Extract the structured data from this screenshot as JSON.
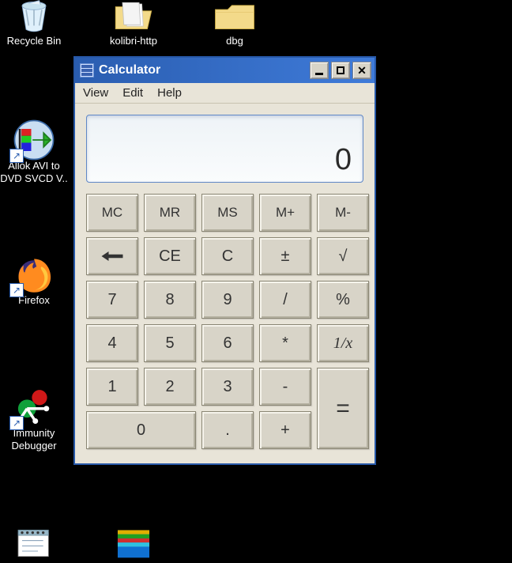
{
  "desktop": {
    "recycle_bin": "Recycle Bin",
    "kolibri": "kolibri-http",
    "dbg": "dbg",
    "allok": "Allok AVI to DVD SVCD V..",
    "firefox": "Firefox",
    "immunity": "Immunity Debugger"
  },
  "window": {
    "title": "Calculator",
    "menu": {
      "view": "View",
      "edit": "Edit",
      "help": "Help"
    },
    "display": "0",
    "keys": {
      "mc": "MC",
      "mr": "MR",
      "ms": "MS",
      "mplus": "M+",
      "mminus": "M-",
      "ce": "CE",
      "c": "C",
      "pm": "±",
      "sqrt": "√",
      "k7": "7",
      "k8": "8",
      "k9": "9",
      "div": "/",
      "pct": "%",
      "k4": "4",
      "k5": "5",
      "k6": "6",
      "mul": "*",
      "recip": "1/x",
      "k1": "1",
      "k2": "2",
      "k3": "3",
      "minus": "-",
      "k0": "0",
      "dot": ".",
      "plus": "+",
      "eq": "="
    }
  }
}
